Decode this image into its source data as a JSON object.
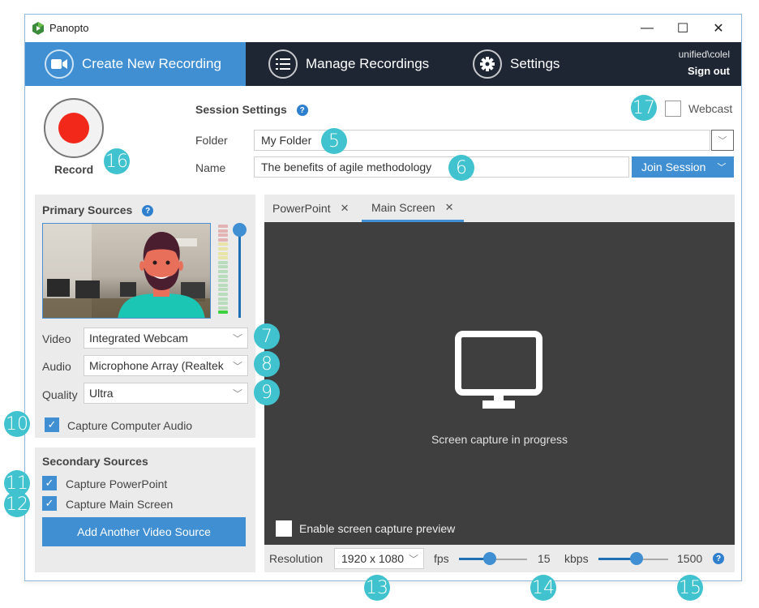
{
  "window": {
    "title": "Panopto",
    "controls": {
      "minimize": "—",
      "maximize": "☐",
      "close": "✕"
    }
  },
  "nav": {
    "tabs": [
      {
        "label": "Create New Recording",
        "icon": "video-camera-icon",
        "active": true
      },
      {
        "label": "Manage Recordings",
        "icon": "list-icon",
        "active": false
      },
      {
        "label": "Settings",
        "icon": "gear-icon",
        "active": false
      }
    ],
    "user": "unified\\colel",
    "sign_out": "Sign out"
  },
  "record": {
    "label": "Record",
    "color": "#f2291a"
  },
  "session": {
    "title": "Session Settings",
    "help": "?",
    "folder_label": "Folder",
    "folder_value": "My Folder",
    "name_label": "Name",
    "name_value": "The benefits of agile methodology",
    "join_session": "Join Session",
    "webcast_label": "Webcast",
    "webcast_checked": false
  },
  "primary_sources": {
    "title": "Primary Sources",
    "help": "?",
    "volume_level": 1.0,
    "video_label": "Video",
    "video_value": "Integrated Webcam",
    "audio_label": "Audio",
    "audio_value": "Microphone Array (Realtek",
    "quality_label": "Quality",
    "quality_value": "Ultra",
    "capture_computer_audio": "Capture Computer Audio",
    "capture_computer_audio_checked": true
  },
  "secondary_sources": {
    "title": "Secondary Sources",
    "capture_powerpoint": "Capture PowerPoint",
    "capture_powerpoint_checked": true,
    "capture_main_screen": "Capture Main Screen",
    "capture_main_screen_checked": true,
    "add_source": "Add Another Video Source"
  },
  "source_tabs": [
    {
      "label": "PowerPoint",
      "close": "✕",
      "active": false
    },
    {
      "label": "Main Screen",
      "close": "✕",
      "active": true
    }
  ],
  "capture": {
    "status": "Screen capture in progress",
    "enable_preview": "Enable screen capture preview",
    "enable_preview_checked": false,
    "resolution_label": "Resolution",
    "resolution_value": "1920 x 1080",
    "fps_label": "fps",
    "fps_value": "15",
    "fps_position": 0.45,
    "kbps_label": "kbps",
    "kbps_value": "1500",
    "kbps_position": 0.55,
    "help": "?"
  },
  "callouts": [
    "5",
    "6",
    "7",
    "8",
    "9",
    "10",
    "11",
    "12",
    "13",
    "14",
    "15",
    "16",
    "17"
  ],
  "colors": {
    "accent": "#3f8fd2",
    "nav_bg": "#1f2633",
    "callout": "#41c3cf",
    "canvas": "#3f3f3f"
  }
}
